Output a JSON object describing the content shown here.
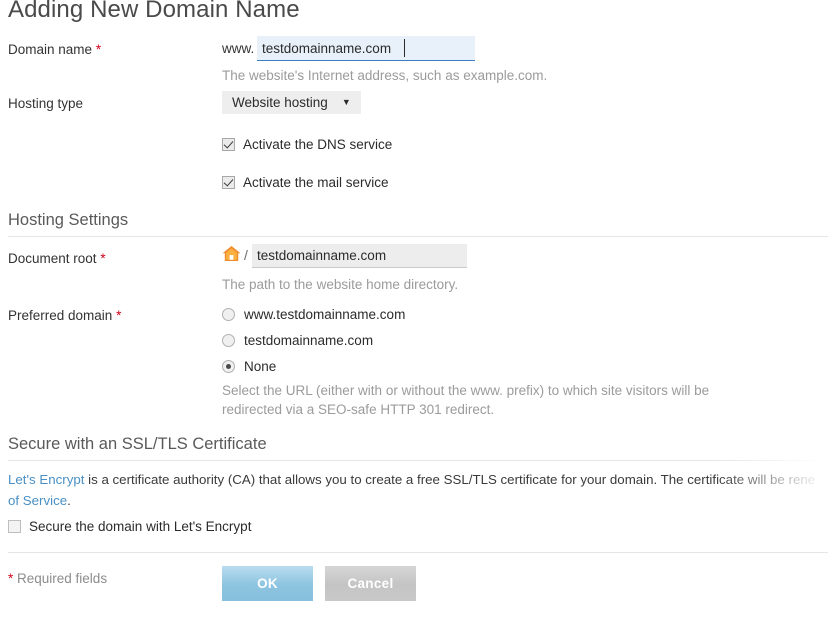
{
  "page": {
    "title": "Adding New Domain Name"
  },
  "domain_name": {
    "label": "Domain name",
    "required_marker": "*",
    "prefix": "www.",
    "value": "testdomainname.com",
    "placeholder": "",
    "hint": "The website's Internet address, such as example.com."
  },
  "hosting_type": {
    "label": "Hosting type",
    "selected": "Website hosting",
    "caret": "▼",
    "options": [
      "Website hosting"
    ]
  },
  "services": [
    {
      "label": "Activate the DNS service",
      "checked": true
    },
    {
      "label": "Activate the mail service",
      "checked": true
    }
  ],
  "hosting_settings": {
    "section_title": "Hosting Settings",
    "document_root": {
      "label": "Document root",
      "required_marker": "*",
      "home_icon": "home-icon",
      "separator": "/",
      "value": "testdomainname.com",
      "hint": "The path to the website home directory."
    },
    "preferred_domain": {
      "label": "Preferred domain",
      "required_marker": "*",
      "options": [
        {
          "label": "www.testdomainname.com",
          "selected": false
        },
        {
          "label": "testdomainname.com",
          "selected": false
        },
        {
          "label": "None",
          "selected": true
        }
      ],
      "hint_line1": "Select the URL (either with or without the www. prefix) to which site visitors will be",
      "hint_line2": "redirected via a SEO-safe HTTP 301 redirect."
    }
  },
  "ssl": {
    "section_title": "Secure with an SSL/TLS Certificate",
    "paragraph_link1": "Let's Encrypt",
    "paragraph_part1": " is a certificate authority (CA) that allows you to create a free SSL/TLS certificate for your domain. The certificate ",
    "paragraph_part2": "will be rene",
    "paragraph_link2": "of Service",
    "paragraph_part3": ".",
    "checkbox": {
      "label": "Secure the domain with Let's Encrypt",
      "checked": false
    }
  },
  "footer": {
    "required_star": "*",
    "required_text": " Required fields",
    "ok_label": "OK",
    "cancel_label": "Cancel"
  },
  "colors": {
    "accent_link": "#4a90c4",
    "required_red": "#d0021b",
    "ok_button": "#8dc4e0",
    "cancel_button": "#c4c4c4",
    "focus_field_bg": "#e8f1fa",
    "home_icon": "#f08b2c"
  }
}
